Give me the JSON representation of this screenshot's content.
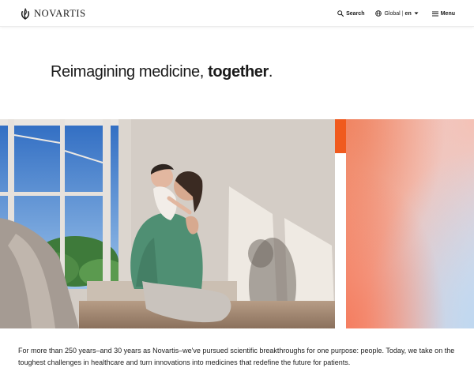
{
  "header": {
    "brand": "NOVARTIS",
    "search_label": "Search",
    "region_label": "Global",
    "separator": "|",
    "language_label": "en",
    "menu_label": "Menu"
  },
  "hero": {
    "headline_regular": "Reimagining medicine, ",
    "headline_bold": "together",
    "headline_end": "."
  },
  "intro": {
    "text": "For more than 250 years–and 30 years as Novartis–we've pursued scientific breakthroughs for one purpose: people. Today, we take on the toughest challenges in healthcare and turn innovations into medicines that redefine the future for patients."
  },
  "colors": {
    "accent_orange": "#f05a1e",
    "text": "#1a1a1a",
    "background": "#ffffff"
  },
  "icons": {
    "logo": "novartis-flame-icon",
    "search": "search-icon",
    "globe": "globe-icon",
    "caret": "chevron-down-icon",
    "menu": "hamburger-icon"
  }
}
